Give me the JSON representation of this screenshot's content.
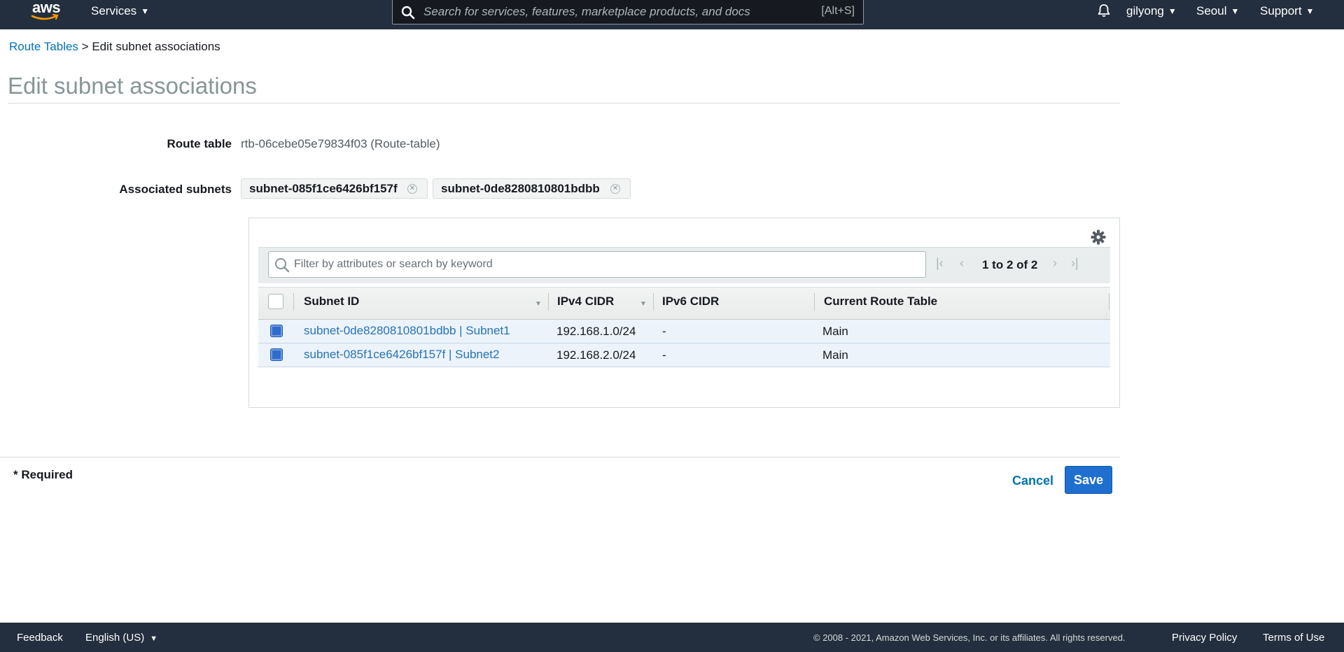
{
  "topnav": {
    "logo_text": "aws",
    "services_label": "Services",
    "search_placeholder": "Search for services, features, marketplace products, and docs",
    "search_shortcut": "[Alt+S]",
    "user": "gilyong",
    "region": "Seoul",
    "support": "Support"
  },
  "breadcrumb": {
    "parent": "Route Tables",
    "separator": ">",
    "current": "Edit subnet associations"
  },
  "page_title": "Edit subnet associations",
  "route_table": {
    "label": "Route table",
    "value": "rtb-06cebe05e79834f03 (Route-table)"
  },
  "associated_subnets": {
    "label": "Associated subnets",
    "tokens": [
      "subnet-085f1ce6426bf157f",
      "subnet-0de8280810801bdbb"
    ]
  },
  "table": {
    "filter_placeholder": "Filter by attributes or search by keyword",
    "pagination": "1 to 2 of 2",
    "columns": [
      "Subnet ID",
      "IPv4 CIDR",
      "IPv6 CIDR",
      "Current Route Table"
    ],
    "rows": [
      {
        "selected": true,
        "subnet": "subnet-0de8280810801bdbb | Subnet1",
        "ipv4": "192.168.1.0/24",
        "ipv6": "-",
        "route_table": "Main"
      },
      {
        "selected": true,
        "subnet": "subnet-085f1ce6426bf157f | Subnet2",
        "ipv4": "192.168.2.0/24",
        "ipv6": "-",
        "route_table": "Main"
      }
    ]
  },
  "form": {
    "required_note": "* Required",
    "cancel_label": "Cancel",
    "save_label": "Save"
  },
  "footer": {
    "feedback": "Feedback",
    "language": "English (US)",
    "copyright": "© 2008 - 2021, Amazon Web Services, Inc. or its affiliates. All rights reserved.",
    "privacy": "Privacy Policy",
    "terms": "Terms of Use"
  },
  "colors": {
    "nav_bg": "#232f3e",
    "link": "#0073bb",
    "save_button": "#1f6fd1",
    "selected_row": "#ecf3fb"
  }
}
